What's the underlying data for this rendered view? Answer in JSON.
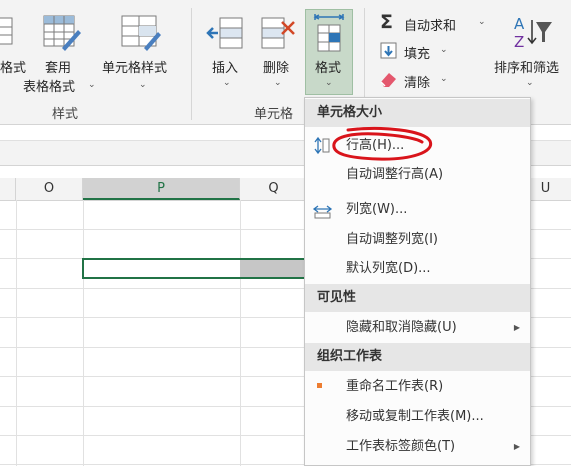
{
  "ribbon": {
    "styles_group": {
      "partial_left_label": "格式",
      "table_format_line1": "套用",
      "table_format_line2": "表格格式",
      "cell_styles": "单元格样式",
      "group_label": "样式"
    },
    "cells_group": {
      "insert": "插入",
      "delete": "删除",
      "format": "格式",
      "group_label": "单元格"
    },
    "editing_group": {
      "autosum": "自动求和",
      "fill": "填充",
      "clear": "清除",
      "sort_filter": "排序和筛选"
    },
    "caret": "⌄"
  },
  "grid": {
    "columns": [
      "O",
      "P",
      "Q",
      "U"
    ]
  },
  "menu": {
    "sections": [
      {
        "header": "单元格大小",
        "items": [
          {
            "label": "行高(H)...",
            "icon": "row-height-icon"
          },
          {
            "label": "自动调整行高(A)"
          },
          {
            "label": "列宽(W)...",
            "icon": "column-width-icon"
          },
          {
            "label": "自动调整列宽(I)"
          },
          {
            "label": "默认列宽(D)..."
          }
        ]
      },
      {
        "header": "可见性",
        "items": [
          {
            "label": "隐藏和取消隐藏(U)",
            "submenu": true
          }
        ]
      },
      {
        "header": "组织工作表",
        "items": [
          {
            "label": "重命名工作表(R)",
            "icon": "bullet-icon"
          },
          {
            "label": "移动或复制工作表(M)..."
          },
          {
            "label": "工作表标签颜色(T)",
            "submenu": true
          }
        ]
      }
    ],
    "submenu_arrow": "▶"
  },
  "colors": {
    "accent_green": "#217346",
    "annotation_red": "#d9141b",
    "format_pressed": "#c8d9c9"
  }
}
